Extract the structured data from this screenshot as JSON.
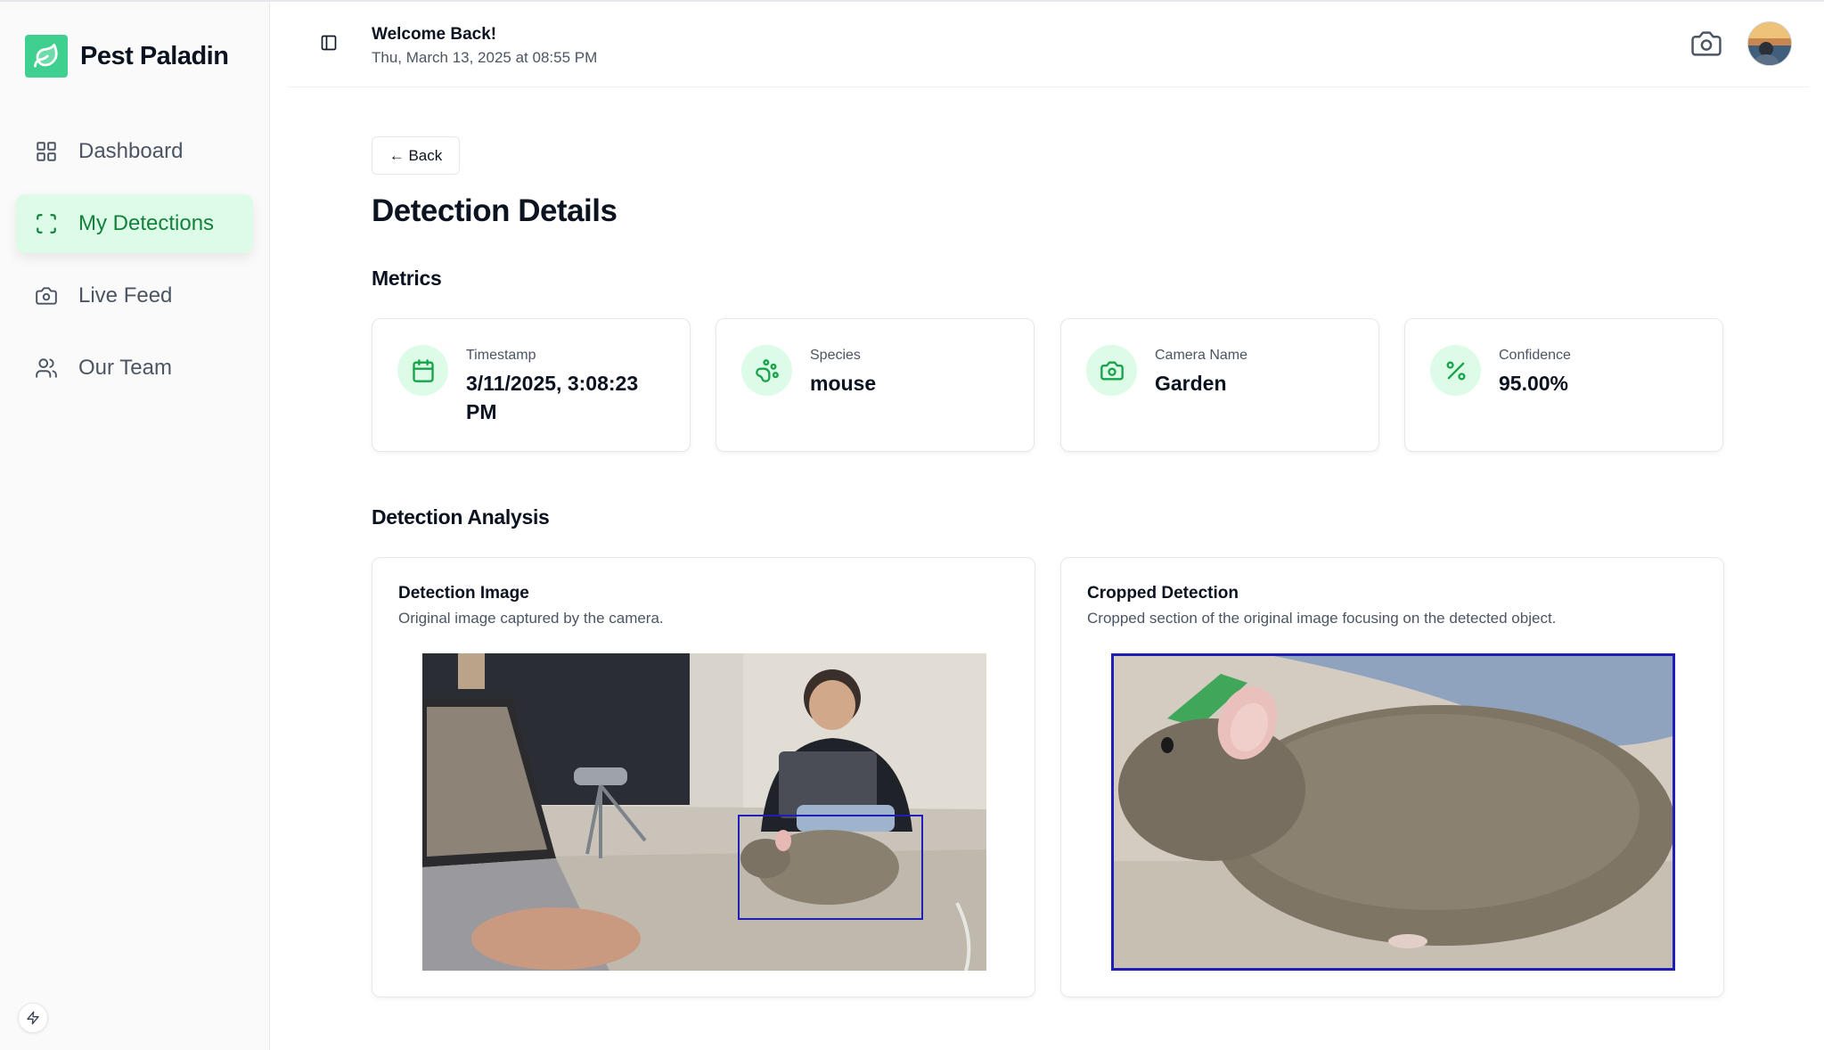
{
  "brand": {
    "name": "Pest Paladin"
  },
  "sidebar": {
    "items": [
      {
        "label": "Dashboard",
        "icon": "grid-icon",
        "active": false
      },
      {
        "label": "My Detections",
        "icon": "scan-icon",
        "active": true
      },
      {
        "label": "Live Feed",
        "icon": "camera-icon",
        "active": false
      },
      {
        "label": "Our Team",
        "icon": "users-icon",
        "active": false
      }
    ]
  },
  "header": {
    "welcome": "Welcome Back!",
    "datetime": "Thu, March 13, 2025 at 08:55 PM"
  },
  "main": {
    "back_label": "← Back",
    "title": "Detection Details",
    "metrics_title": "Metrics",
    "metrics": [
      {
        "label": "Timestamp",
        "value": "3/11/2025, 3:08:23 PM",
        "icon": "calendar-icon"
      },
      {
        "label": "Species",
        "value": "mouse",
        "icon": "paw-icon"
      },
      {
        "label": "Camera Name",
        "value": "Garden",
        "icon": "camera-icon"
      },
      {
        "label": "Confidence",
        "value": "95.00%",
        "icon": "percent-icon"
      }
    ],
    "analysis_title": "Detection Analysis",
    "detection_image": {
      "title": "Detection Image",
      "description": "Original image captured by the camera."
    },
    "cropped_detection": {
      "title": "Cropped Detection",
      "description": "Cropped section of the original image focusing on the detected object."
    }
  },
  "colors": {
    "accent": "#3fcf8e",
    "active_bg": "#dcfce7",
    "active_text": "#15803d",
    "bbox": "#1f1fb8"
  }
}
